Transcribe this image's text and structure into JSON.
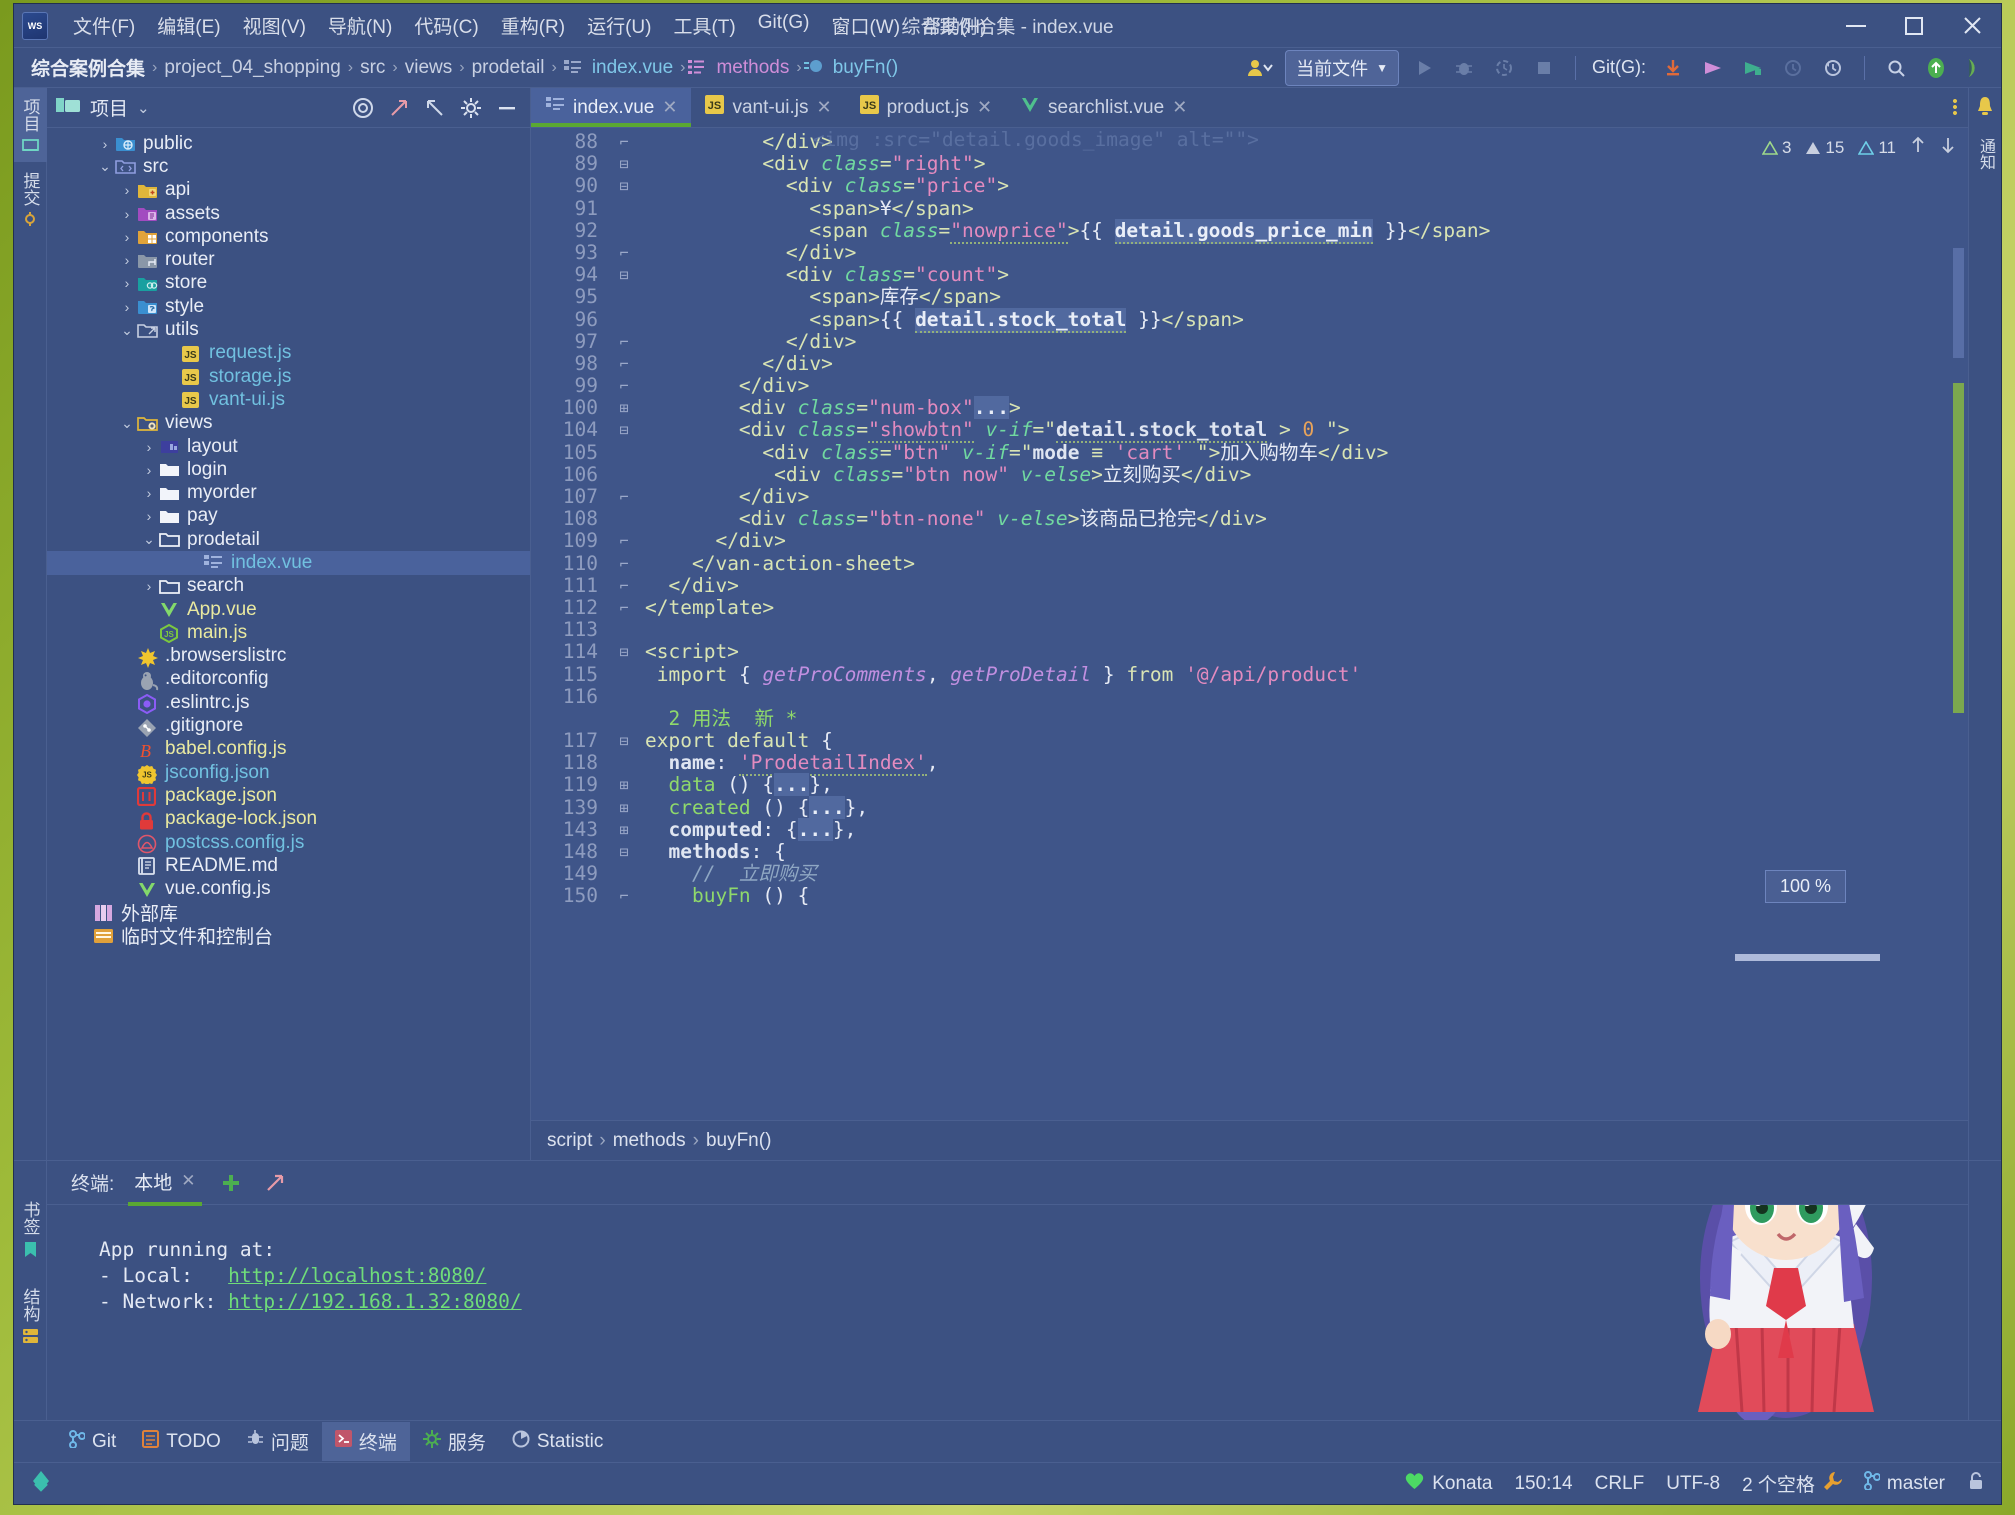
{
  "window": {
    "title": "综合案例合集 - index.vue",
    "minimize": "—",
    "maximize": "▢",
    "close": "✕"
  },
  "menu": [
    "文件(F)",
    "编辑(E)",
    "视图(V)",
    "导航(N)",
    "代码(C)",
    "重构(R)",
    "运行(U)",
    "工具(T)",
    "Git(G)",
    "窗口(W)",
    "帮助(H)"
  ],
  "breadcrumb": [
    {
      "text": "综合案例合集",
      "style": "bold"
    },
    {
      "text": "project_04_shopping",
      "style": "plain"
    },
    {
      "text": "src",
      "style": "plain"
    },
    {
      "text": "views",
      "style": "plain"
    },
    {
      "text": "prodetail",
      "style": "plain"
    },
    {
      "text": "index.vue",
      "style": "link"
    },
    {
      "text": "methods",
      "style": "pink"
    },
    {
      "text": "buyFn()",
      "style": "link"
    }
  ],
  "toolbar": {
    "run_config": "当前文件",
    "git_label": "Git(G):",
    "icons": [
      "run-icon",
      "debug-icon",
      "coverage-icon",
      "stop-icon",
      "git-update-icon",
      "git-commit-icon",
      "git-push-icon",
      "history-icon",
      "rollback-icon",
      "search-icon",
      "up-icon",
      "ide-icon"
    ]
  },
  "left_tool_tabs": [
    {
      "label": "项目",
      "active": true
    },
    {
      "label": "提交",
      "active": false
    }
  ],
  "left_bottom_tabs": [
    {
      "label": "书签"
    },
    {
      "label": "结构"
    }
  ],
  "right_tool_tabs": [
    {
      "label": "通知"
    }
  ],
  "project_panel": {
    "title": "项目",
    "tree": [
      {
        "indent": 2,
        "arrow": "›",
        "icon": "folder-public",
        "label": "public",
        "color": "white"
      },
      {
        "indent": 2,
        "arrow": "⌄",
        "icon": "folder-src",
        "label": "src",
        "color": "white"
      },
      {
        "indent": 3,
        "arrow": "›",
        "icon": "folder-api",
        "label": "api",
        "color": "white"
      },
      {
        "indent": 3,
        "arrow": "›",
        "icon": "folder-assets",
        "label": "assets",
        "color": "white"
      },
      {
        "indent": 3,
        "arrow": "›",
        "icon": "folder-components",
        "label": "components",
        "color": "white"
      },
      {
        "indent": 3,
        "arrow": "›",
        "icon": "folder-router",
        "label": "router",
        "color": "white"
      },
      {
        "indent": 3,
        "arrow": "›",
        "icon": "folder-store",
        "label": "store",
        "color": "white"
      },
      {
        "indent": 3,
        "arrow": "›",
        "icon": "folder-style",
        "label": "style",
        "color": "white"
      },
      {
        "indent": 3,
        "arrow": "⌄",
        "icon": "folder-utils",
        "label": "utils",
        "color": "white"
      },
      {
        "indent": 5,
        "arrow": "",
        "icon": "js-file",
        "label": "request.js",
        "color": "blue"
      },
      {
        "indent": 5,
        "arrow": "",
        "icon": "js-file",
        "label": "storage.js",
        "color": "blue"
      },
      {
        "indent": 5,
        "arrow": "",
        "icon": "js-file",
        "label": "vant-ui.js",
        "color": "blue"
      },
      {
        "indent": 3,
        "arrow": "⌄",
        "icon": "folder-views",
        "label": "views",
        "color": "white"
      },
      {
        "indent": 4,
        "arrow": "›",
        "icon": "folder-layout",
        "label": "layout",
        "color": "white"
      },
      {
        "indent": 4,
        "arrow": "›",
        "icon": "folder-plain",
        "label": "login",
        "color": "white"
      },
      {
        "indent": 4,
        "arrow": "›",
        "icon": "folder-plain",
        "label": "myorder",
        "color": "white"
      },
      {
        "indent": 4,
        "arrow": "›",
        "icon": "folder-plain",
        "label": "pay",
        "color": "white"
      },
      {
        "indent": 4,
        "arrow": "⌄",
        "icon": "folder-open",
        "label": "prodetail",
        "color": "white"
      },
      {
        "indent": 6,
        "arrow": "",
        "icon": "vue-html-file",
        "label": "index.vue",
        "color": "blue",
        "selected": true
      },
      {
        "indent": 4,
        "arrow": "›",
        "icon": "folder-open",
        "label": "search",
        "color": "white"
      },
      {
        "indent": 4,
        "arrow": "",
        "icon": "vue-file",
        "label": "App.vue",
        "color": "yellow"
      },
      {
        "indent": 4,
        "arrow": "",
        "icon": "node-file",
        "label": "main.js",
        "color": "yellow"
      },
      {
        "indent": 3,
        "arrow": "",
        "icon": "browserslist-file",
        "label": ".browserslistrc",
        "color": "white"
      },
      {
        "indent": 3,
        "arrow": "",
        "icon": "editorconfig-file",
        "label": ".editorconfig",
        "color": "white"
      },
      {
        "indent": 3,
        "arrow": "",
        "icon": "eslint-file",
        "label": ".eslintrc.js",
        "color": "white"
      },
      {
        "indent": 3,
        "arrow": "",
        "icon": "git-file",
        "label": ".gitignore",
        "color": "white"
      },
      {
        "indent": 3,
        "arrow": "",
        "icon": "babel-file",
        "label": "babel.config.js",
        "color": "yellow"
      },
      {
        "indent": 3,
        "arrow": "",
        "icon": "jsconfig-file",
        "label": "jsconfig.json",
        "color": "blue"
      },
      {
        "indent": 3,
        "arrow": "",
        "icon": "package-file",
        "label": "package.json",
        "color": "yellow"
      },
      {
        "indent": 3,
        "arrow": "",
        "icon": "lock-file",
        "label": "package-lock.json",
        "color": "yellow"
      },
      {
        "indent": 3,
        "arrow": "",
        "icon": "postcss-file",
        "label": "postcss.config.js",
        "color": "blue"
      },
      {
        "indent": 3,
        "arrow": "",
        "icon": "readme-file",
        "label": "README.md",
        "color": "white"
      },
      {
        "indent": 3,
        "arrow": "",
        "icon": "vue-file",
        "label": "vue.config.js",
        "color": "white"
      },
      {
        "indent": 1,
        "arrow": "",
        "icon": "library-icon",
        "label": "外部库",
        "color": "white"
      },
      {
        "indent": 1,
        "arrow": "",
        "icon": "scratch-icon",
        "label": "临时文件和控制台",
        "color": "white"
      }
    ]
  },
  "editor": {
    "tabs": [
      {
        "label": "index.vue",
        "icon": "vue-html-file",
        "active": true
      },
      {
        "label": "vant-ui.js",
        "icon": "js-file",
        "active": false
      },
      {
        "label": "product.js",
        "icon": "js-file",
        "active": false
      },
      {
        "label": "searchlist.vue",
        "icon": "vue-file",
        "active": false
      }
    ],
    "inspections": {
      "weak": "3",
      "warnings": "15",
      "typos": "11"
    },
    "zoom": "100 %",
    "top_partial_line": "<img :src=\"detail.goods_image\" alt=\"\">",
    "lines": [
      {
        "no": "88",
        "fold": "end",
        "html": "          <span class=\"k-tag\">&lt;/div&gt;</span>"
      },
      {
        "no": "89",
        "fold": "mid",
        "html": "          <span class=\"k-tag\">&lt;div </span><span class=\"k-attr\">class</span><span class=\"k-tag\">=</span><span class=\"k-str\">\"right\"</span><span class=\"k-tag\">&gt;</span>"
      },
      {
        "no": "90",
        "fold": "mid",
        "html": "            <span class=\"k-tag\">&lt;div </span><span class=\"k-attr\">class</span><span class=\"k-tag\">=</span><span class=\"k-str\">\"price\"</span><span class=\"k-tag\">&gt;</span>"
      },
      {
        "no": "91",
        "fold": "",
        "html": "              <span class=\"k-tag\">&lt;span&gt;</span><span class=\"k-txt\">¥</span><span class=\"k-tag\">&lt;/span&gt;</span>"
      },
      {
        "no": "92",
        "fold": "",
        "html": "              <span class=\"k-tag\">&lt;span </span><span class=\"k-attr\">class</span><span class=\"k-tag\">=</span><span class=\"k-str sq\">\"nowprice\"</span><span class=\"k-tag\">&gt;</span><span class=\"k-txt\">{{ </span><span class=\"k-bind sq\">detail.goods_price_min</span><span class=\"k-txt\"> }}</span><span class=\"k-tag\">&lt;/span&gt;</span>"
      },
      {
        "no": "93",
        "fold": "end",
        "html": "            <span class=\"k-tag\">&lt;/div&gt;</span>"
      },
      {
        "no": "94",
        "fold": "mid",
        "html": "            <span class=\"k-tag\">&lt;div </span><span class=\"k-attr\">class</span><span class=\"k-tag\">=</span><span class=\"k-str\">\"count\"</span><span class=\"k-tag\">&gt;</span>"
      },
      {
        "no": "95",
        "fold": "",
        "html": "              <span class=\"k-tag\">&lt;span&gt;</span><span class=\"k-txt\">库存</span><span class=\"k-tag\">&lt;/span&gt;</span>"
      },
      {
        "no": "96",
        "fold": "",
        "html": "              <span class=\"k-tag\">&lt;span&gt;</span><span class=\"k-txt\">{{ </span><span class=\"k-bind sq\">detail.stock_total</span><span class=\"k-txt\"> }}</span><span class=\"k-tag\">&lt;/span&gt;</span>"
      },
      {
        "no": "97",
        "fold": "end",
        "html": "            <span class=\"k-tag\">&lt;/div&gt;</span>"
      },
      {
        "no": "98",
        "fold": "end",
        "html": "          <span class=\"k-tag\">&lt;/div&gt;</span>"
      },
      {
        "no": "99",
        "fold": "end",
        "html": "        <span class=\"k-tag\">&lt;/div&gt;</span>"
      },
      {
        "no": "100",
        "fold": "plus",
        "html": "        <span class=\"k-tag\">&lt;div </span><span class=\"k-attr\">class</span><span class=\"k-tag\">=</span><span class=\"k-str\">\"num-box\"</span><span class=\"k-bind\">...</span><span class=\"k-tag\">&gt;</span>"
      },
      {
        "no": "104",
        "fold": "mid",
        "html": "        <span class=\"k-tag\">&lt;div </span><span class=\"k-attr\">class</span><span class=\"k-tag\">=</span><span class=\"k-str sq\">\"showbtn\"</span><span class=\"k-tag\"> </span><span class=\"k-attr\">v-if</span><span class=\"k-tag\">=</span><span class=\"k-tag\">\"</span><span class=\"k-prop sq\">detail.stock_total</span><span class=\"k-tag\"> &gt; </span><span class=\"k-num\">0</span><span class=\"k-tag\"> \"&gt;</span>"
      },
      {
        "no": "105",
        "fold": "",
        "html": "          <span class=\"k-tag\">&lt;div </span><span class=\"k-attr\">class</span><span class=\"k-tag\">=</span><span class=\"k-str\">\"btn\"</span><span class=\"k-tag\"> </span><span class=\"k-attr\">v-if</span><span class=\"k-tag\">=</span><span class=\"k-tag\">\"</span><span class=\"k-prop\">mode</span><span class=\"k-tag\"> ≡ </span><span class=\"k-str\">'cart'</span><span class=\"k-tag\"> \"&gt;</span><span class=\"k-txt\">加入购物车</span><span class=\"k-tag\">&lt;/div&gt;</span>"
      },
      {
        "no": "106",
        "fold": "",
        "html": "           <span class=\"k-tag\">&lt;div </span><span class=\"k-attr\">class</span><span class=\"k-tag\">=</span><span class=\"k-str\">\"btn now\"</span><span class=\"k-tag\"> </span><span class=\"k-attr\">v-else</span><span class=\"k-tag\">&gt;</span><span class=\"k-txt\">立刻购买</span><span class=\"k-tag\">&lt;/div&gt;</span>"
      },
      {
        "no": "107",
        "fold": "end",
        "html": "        <span class=\"k-tag\">&lt;/div&gt;</span>"
      },
      {
        "no": "108",
        "fold": "",
        "html": "        <span class=\"k-tag\">&lt;div </span><span class=\"k-attr\">class</span><span class=\"k-tag\">=</span><span class=\"k-str\">\"btn-none\"</span><span class=\"k-tag\"> </span><span class=\"k-attr\">v-else</span><span class=\"k-tag\">&gt;</span><span class=\"k-txt\">该商品已抢完</span><span class=\"k-tag\">&lt;/div&gt;</span>"
      },
      {
        "no": "109",
        "fold": "end",
        "html": "      <span class=\"k-tag\">&lt;/div&gt;</span>"
      },
      {
        "no": "110",
        "fold": "end",
        "html": "    <span class=\"k-tag\">&lt;/van-action-sheet&gt;</span>"
      },
      {
        "no": "111",
        "fold": "end",
        "html": "  <span class=\"k-tag\">&lt;/div&gt;</span>"
      },
      {
        "no": "112",
        "fold": "end",
        "html": "<span class=\"k-tag\">&lt;/template&gt;</span>"
      },
      {
        "no": "113",
        "fold": "",
        "html": ""
      },
      {
        "no": "114",
        "fold": "mid",
        "html": "<span class=\"k-tag\">&lt;script&gt;</span>"
      },
      {
        "no": "115",
        "fold": "",
        "html": " <span class=\"k-kw\">import</span><span class=\"k-txt\"> { </span><span class=\"k-fn\">getProComments</span><span class=\"k-txt\">, </span><span class=\"k-fn\">getProDetail</span><span class=\"k-txt\"> } </span><span class=\"k-kw\">from</span><span class=\"k-txt\"> </span><span class=\"k-str\">'@/api/product'</span>"
      },
      {
        "no": "116",
        "fold": "",
        "html": ""
      },
      {
        "no": "",
        "fold": "",
        "html": "  <span class=\"k-green\">2 用法  新 *</span>"
      },
      {
        "no": "117",
        "fold": "mid",
        "html": "<span class=\"k-kw\">export default</span><span class=\"k-txt\"> {</span>"
      },
      {
        "no": "118",
        "fold": "",
        "html": "  <span class=\"k-prop\">name</span><span class=\"k-txt\">: </span><span class=\"k-str sq\">'ProdetailIndex'</span><span class=\"k-txt\">,</span>"
      },
      {
        "no": "119",
        "fold": "plus",
        "html": "  <span class=\"k-green\">data</span><span class=\"k-txt\"> () {</span><span class=\"k-bind\">...</span><span class=\"k-txt\">},</span>"
      },
      {
        "no": "139",
        "fold": "plus",
        "html": "  <span class=\"k-green\">created</span><span class=\"k-txt\"> () {</span><span class=\"k-bind\">...</span><span class=\"k-txt\">},</span>"
      },
      {
        "no": "143",
        "fold": "plus",
        "html": "  <span class=\"k-prop\">computed</span><span class=\"k-txt\">: {</span><span class=\"k-bind\">...</span><span class=\"k-txt\">},</span>"
      },
      {
        "no": "148",
        "fold": "mid",
        "html": "  <span class=\"k-prop\">methods</span><span class=\"k-txt\">: {</span>"
      },
      {
        "no": "149",
        "fold": "",
        "html": "    <span class=\"k-cmt\">//  立即购买</span>"
      },
      {
        "no": "150",
        "fold": "end",
        "html": "    <span class=\"k-green\">buyFn</span><span class=\"k-txt\"> () {</span>"
      }
    ],
    "status_breadcrumb": [
      "script",
      "methods",
      "buyFn()"
    ]
  },
  "terminal": {
    "label": "终端:",
    "tab": "本地",
    "add_icon": "add-icon",
    "expand_icon": "expand-icon",
    "lines": [
      {
        "text": "App running at:",
        "type": "plain"
      },
      {
        "text": "- Local:   ",
        "link": "http://localhost:8080/",
        "type": "link"
      },
      {
        "text": "- Network: ",
        "link": "http://192.168.1.32:8080/",
        "type": "link"
      }
    ]
  },
  "bottom_tabs": [
    {
      "label": "Git",
      "icon": "git-branch-icon",
      "active": false
    },
    {
      "label": "TODO",
      "icon": "todo-icon",
      "active": false
    },
    {
      "label": "问题",
      "icon": "problems-icon",
      "active": false
    },
    {
      "label": "终端",
      "icon": "terminal-icon",
      "active": true
    },
    {
      "label": "服务",
      "icon": "services-icon",
      "active": false
    },
    {
      "label": "Statistic",
      "icon": "statistic-icon",
      "active": false
    }
  ],
  "status_bar": {
    "left_icon": "event-log-icon",
    "items": [
      {
        "label": "Konata",
        "icon": "heart-icon"
      },
      {
        "label": "150:14",
        "icon": ""
      },
      {
        "label": "CRLF",
        "icon": ""
      },
      {
        "label": "UTF-8",
        "icon": ""
      },
      {
        "label": "2 个空格",
        "icon": "wrench-icon"
      },
      {
        "label": "master",
        "icon": "git-branch-icon"
      },
      {
        "label": "",
        "icon": "lock-icon"
      }
    ]
  },
  "colors": {
    "bg": "#3c5182",
    "editor_bg": "#3f5589",
    "accent_green": "#5aa832",
    "selection": "#4a629c",
    "link": "#71c1e0"
  }
}
